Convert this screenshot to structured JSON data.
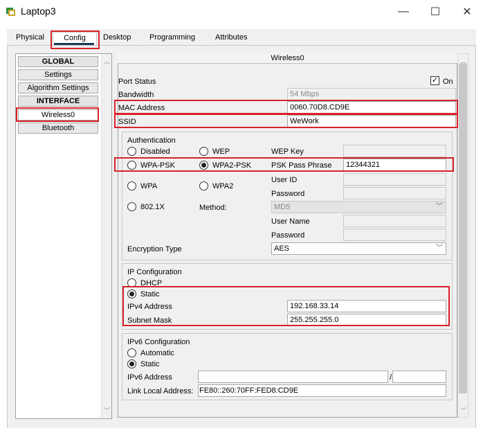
{
  "window": {
    "title": "Laptop3",
    "controls": {
      "minimize": "—",
      "maximize": "☐",
      "close": "✕"
    }
  },
  "tabs": [
    "Physical",
    "Config",
    "Desktop",
    "Programming",
    "Attributes"
  ],
  "nav": {
    "items": [
      "GLOBAL",
      "Settings",
      "Algorithm Settings",
      "INTERFACE",
      "Wireless0",
      "Bluetooth"
    ]
  },
  "panel": {
    "title": "Wireless0",
    "port_status_label": "Port Status",
    "port_status_on_label": "On",
    "bandwidth_label": "Bandwidth",
    "bandwidth_value": "54 Mbps",
    "mac_label": "MAC Address",
    "mac_value": "0060.70D8.CD9E",
    "ssid_label": "SSID",
    "ssid_value": "WeWork"
  },
  "auth": {
    "title": "Authentication",
    "disabled": "Disabled",
    "wep": "WEP",
    "wep_key_label": "WEP Key",
    "wpa_psk": "WPA-PSK",
    "wpa2_psk": "WPA2-PSK",
    "psk_label": "PSK Pass Phrase",
    "psk_value": "12344321",
    "wpa": "WPA",
    "wpa2": "WPA2",
    "user_id_label": "User ID",
    "password_label": "Password",
    "dot1x": "802.1X",
    "method_label": "Method:",
    "method_value": "MD5",
    "user_name_label": "User Name",
    "password2_label": "Password",
    "encryption_label": "Encryption Type",
    "encryption_value": "AES"
  },
  "ip": {
    "title": "IP Configuration",
    "dhcp": "DHCP",
    "static": "Static",
    "ipv4_label": "IPv4 Address",
    "ipv4_value": "192.168.33.14",
    "mask_label": "Subnet Mask",
    "mask_value": "255.255.255.0"
  },
  "ipv6": {
    "title": "IPv6 Configuration",
    "automatic": "Automatic",
    "static": "Static",
    "addr_label": "IPv6 Address",
    "slash": "/",
    "link_local_label": "Link Local Address:",
    "link_local_value": "FE80::260:70FF:FED8:CD9E"
  },
  "colors": {
    "highlight": "#d9212a",
    "tab_underline": "#1a3b5a"
  },
  "icons": {
    "app": "laptop-icon",
    "scroll_up": "chevron-up-icon",
    "scroll_down": "chevron-down-icon"
  }
}
